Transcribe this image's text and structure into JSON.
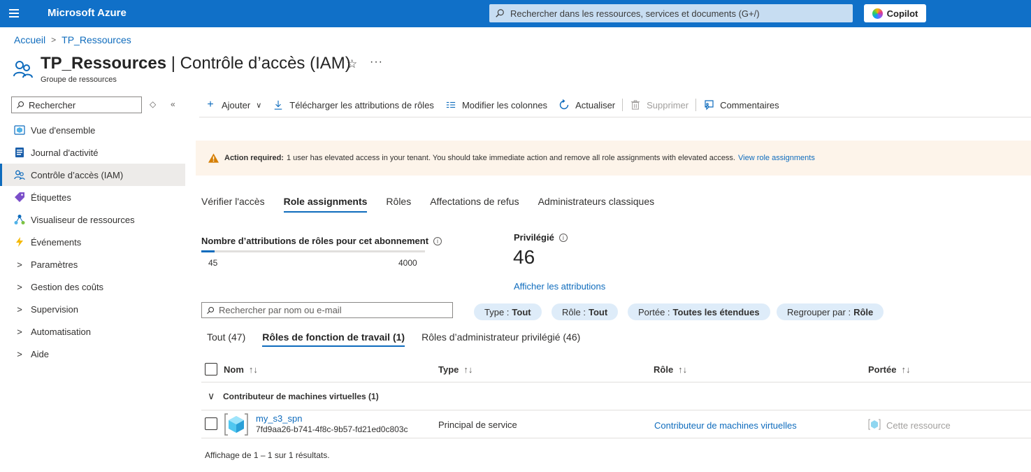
{
  "topbar": {
    "brand": "Microsoft Azure",
    "search_placeholder": "Rechercher dans les ressources, services et documents (G+/)",
    "copilot_label": "Copilot"
  },
  "breadcrumb": [
    "Accueil",
    "TP_Ressources"
  ],
  "header": {
    "title_resource": "TP_Ressources",
    "title_separator": " | ",
    "title_section": "Contrôle d’accès (IAM)",
    "subtitle": "Groupe de ressources",
    "star_icon": "star-icon",
    "more_label": "···"
  },
  "sidebar": {
    "search_placeholder": "Rechercher",
    "items": [
      {
        "label": "Vue d'ensemble",
        "icon": "overview-icon",
        "type": "link"
      },
      {
        "label": "Journal d'activité",
        "icon": "activity-log-icon",
        "type": "link"
      },
      {
        "label": "Contrôle d’accès (IAM)",
        "icon": "people-icon",
        "type": "link",
        "active": true
      },
      {
        "label": "Étiquettes",
        "icon": "tag-icon",
        "type": "link"
      },
      {
        "label": "Visualiseur de ressources",
        "icon": "resource-visualizer-icon",
        "type": "link"
      },
      {
        "label": "Événements",
        "icon": "lightning-icon",
        "type": "link"
      },
      {
        "label": "Paramètres",
        "type": "group"
      },
      {
        "label": "Gestion des coûts",
        "type": "group"
      },
      {
        "label": "Supervision",
        "type": "group"
      },
      {
        "label": "Automatisation",
        "type": "group"
      },
      {
        "label": "Aide",
        "type": "group"
      }
    ]
  },
  "toolbar": {
    "add": "Ajouter",
    "download": "Télécharger les attributions de rôles",
    "edit_columns": "Modifier les colonnes",
    "refresh": "Actualiser",
    "delete": "Supprimer",
    "feedback": "Commentaires"
  },
  "banner": {
    "title": "Action required:",
    "message": "1 user has elevated access in your tenant. You should take immediate action and remove all role assignments with elevated access.",
    "link": "View role assignments",
    "color": "#fdf4ea"
  },
  "tabs": [
    "Vérifier l'accès",
    "Role assignments",
    "Rôles",
    "Affectations de refus",
    "Administrateurs classiques"
  ],
  "active_tab": "Role assignments",
  "stats": {
    "count_label": "Nombre d’attributions de rôles pour cet abonnement",
    "count_current": "45",
    "count_max": "4000",
    "count_fraction": 0.01125,
    "privileged_label": "Privilégié",
    "privileged_value": "46",
    "privileged_link": "Afficher les attributions"
  },
  "filters": {
    "search_placeholder": "Rechercher par nom ou e-mail",
    "pills": [
      {
        "key": "Type :",
        "value": "Tout"
      },
      {
        "key": "Rôle :",
        "value": "Tout"
      },
      {
        "key": "Portée :",
        "value": "Toutes les étendues"
      },
      {
        "key": "Regrouper par :",
        "value": "Rôle"
      }
    ]
  },
  "subtabs": [
    "Tout (47)",
    "Rôles de fonction de travail (1)",
    "Rôles d’administrateur privilégié (46)"
  ],
  "active_subtab": "Rôles de fonction de travail (1)",
  "table": {
    "columns": [
      "Nom",
      "Type",
      "Rôle",
      "Portée"
    ],
    "sort_glyph": "↑↓",
    "group": "Contributeur de machines virtuelles (1)",
    "rows": [
      {
        "name": "my_s3_spn",
        "id": "7fd9aa26-b741-4f8c-9b57-fd21ed0c803c",
        "type": "Principal de service",
        "role": "Contributeur de machines virtuelles",
        "scope": "Cette ressource"
      }
    ],
    "footer": "Affichage de 1 – 1 sur 1 résultats."
  },
  "colors": {
    "topbar": "#1070c8",
    "accent": "#0f6cbd",
    "warning": "#d67f05"
  }
}
